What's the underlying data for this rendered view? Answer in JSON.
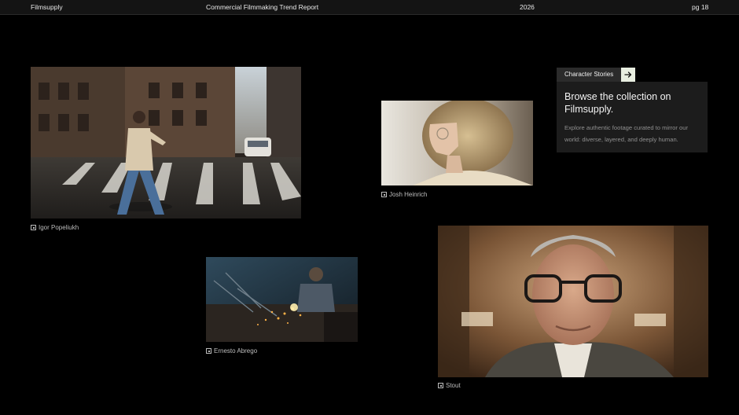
{
  "header": {
    "brand": "Filmsupply",
    "report_title": "Commercial Filmmaking Trend Report",
    "year": "2026",
    "page": "pg 18"
  },
  "photos": [
    {
      "name": "street-walker",
      "credit": "Igor Popeliukh"
    },
    {
      "name": "blonde-profile",
      "credit": "Josh Heinrich"
    },
    {
      "name": "welder",
      "credit": "Ernesto Abrego"
    },
    {
      "name": "old-man-glasses",
      "credit": "Stout"
    }
  ],
  "cta": {
    "tag_label": "Character Stories",
    "heading": "Browse the collection on Filmsupply.",
    "description": "Explore authentic footage curated to mirror our world: diverse, layered, and deeply human.",
    "arrow_icon": "arrow-right-icon",
    "arrow_bg": "#e8eee0"
  },
  "colors": {
    "background": "#000000",
    "topbar": "#141414",
    "card": "#1c1c1c"
  }
}
